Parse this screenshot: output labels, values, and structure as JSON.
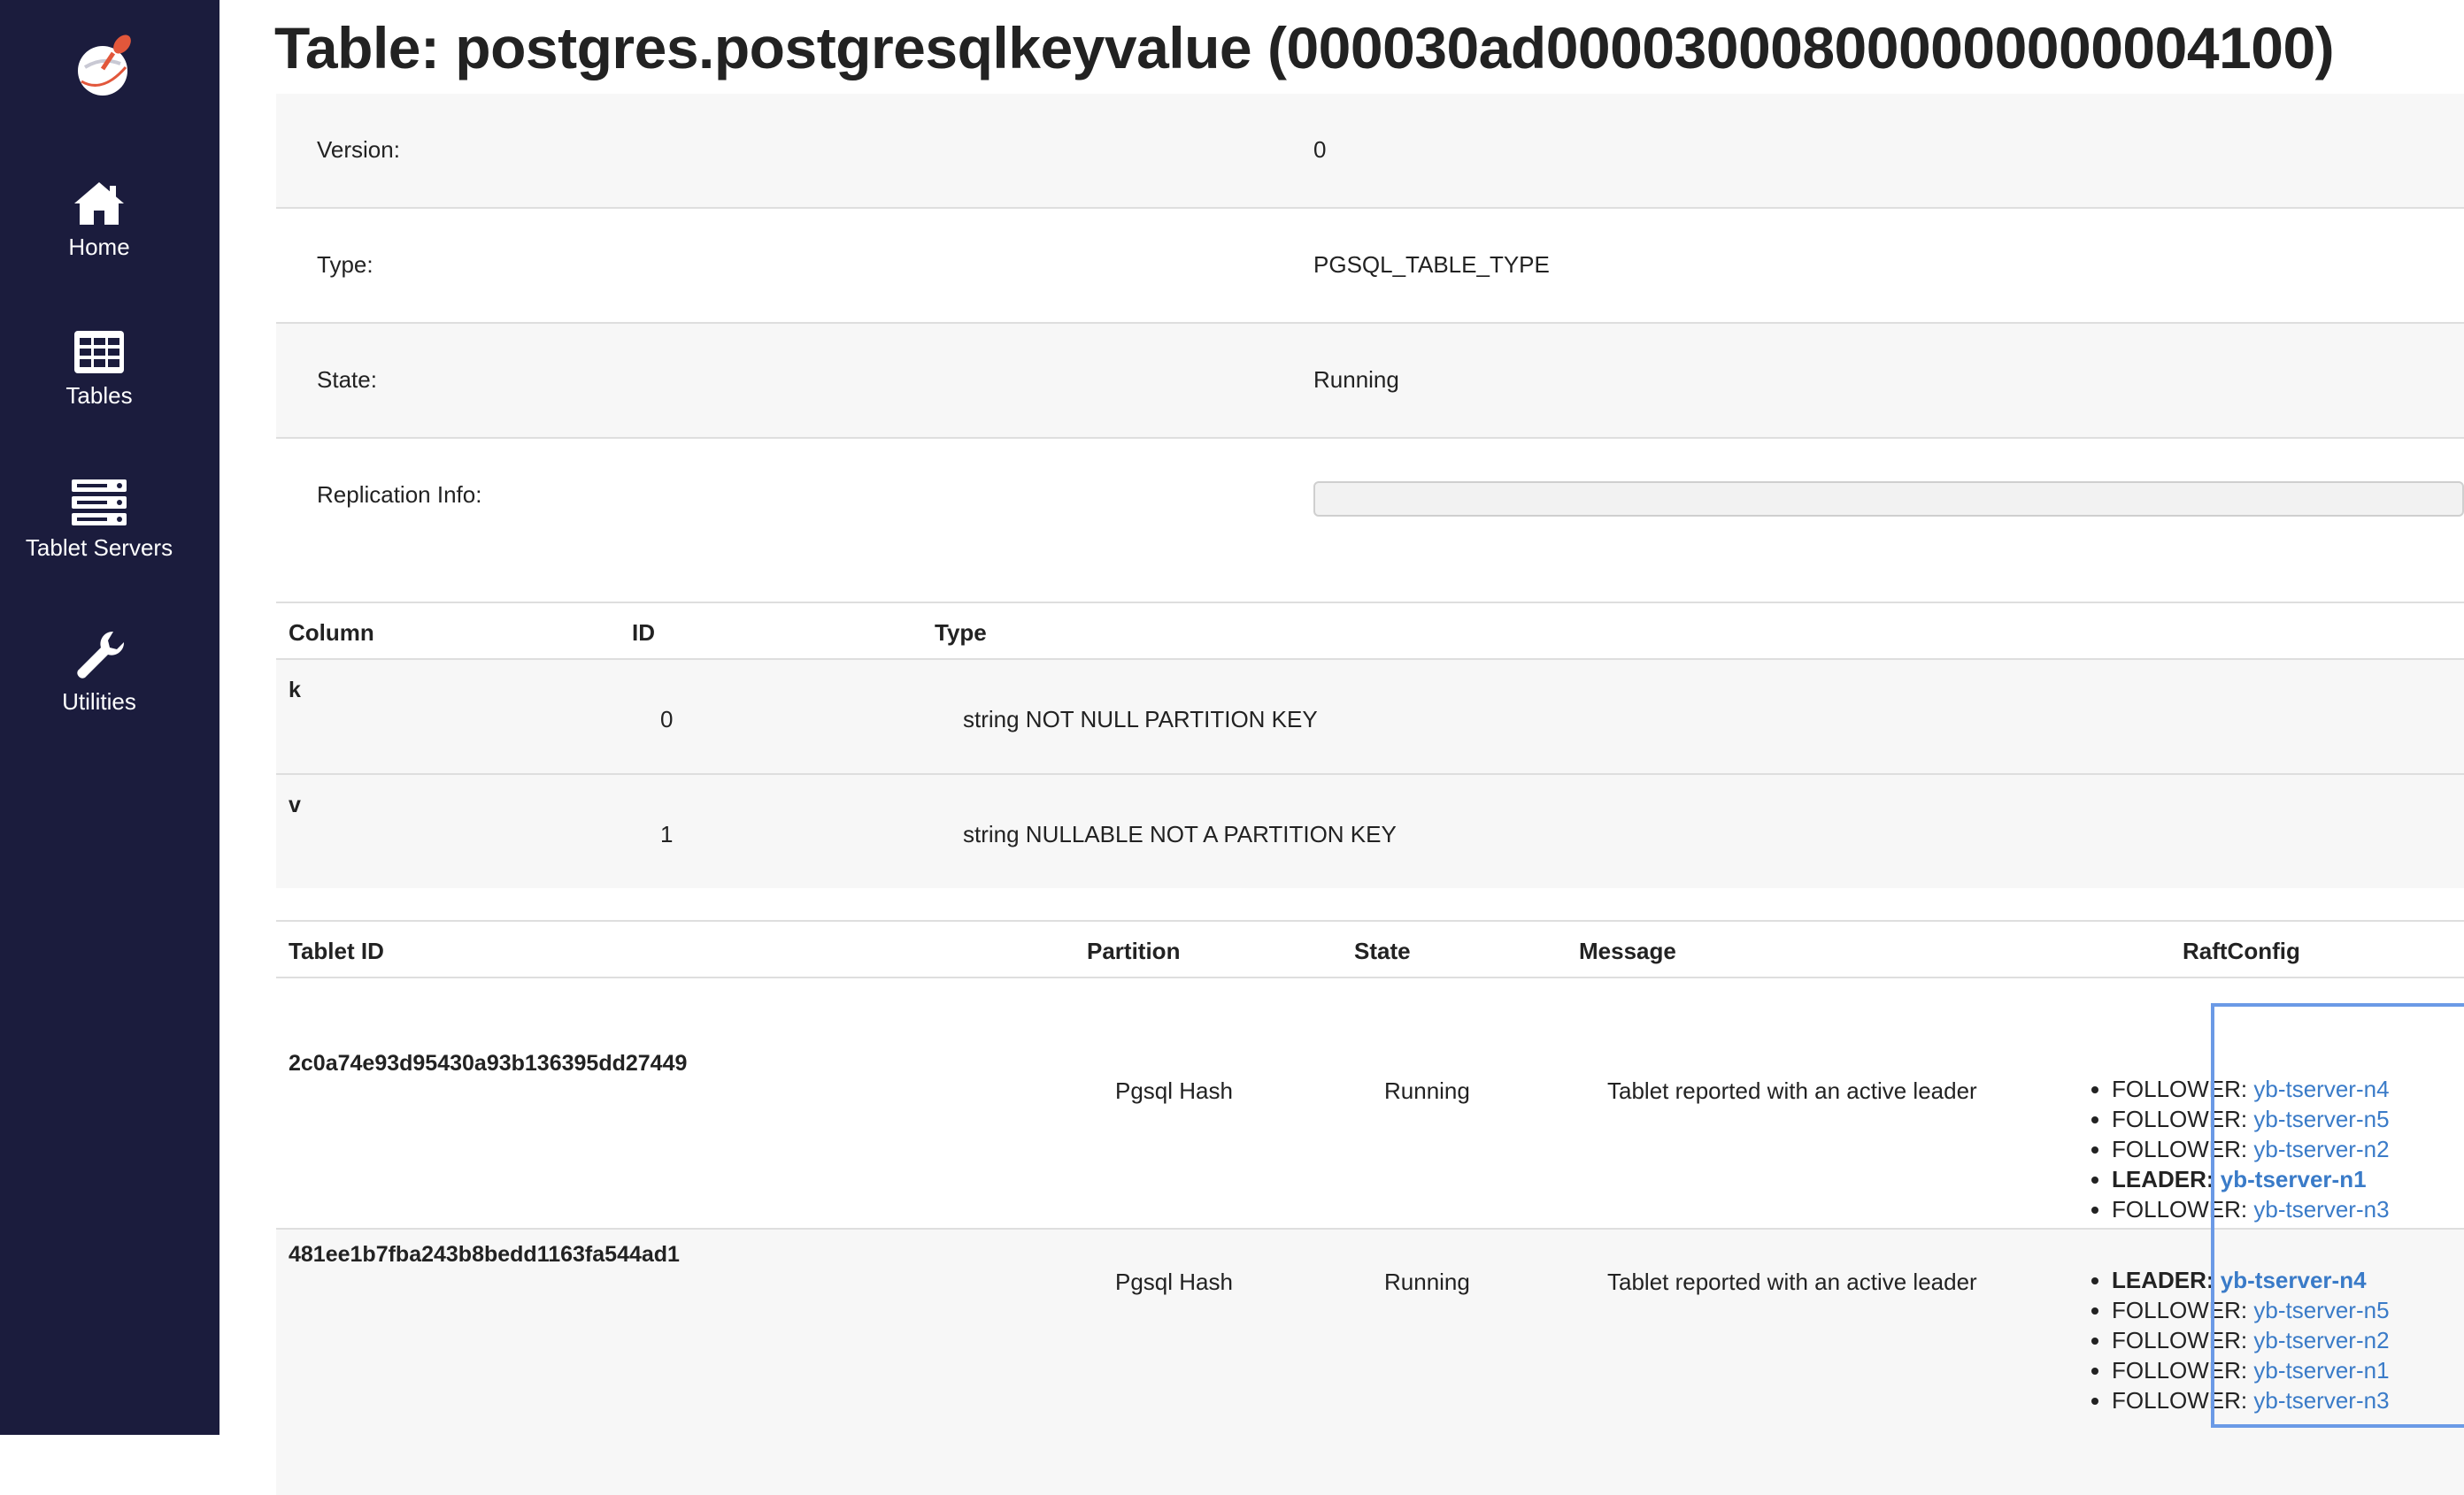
{
  "sidebar": {
    "items": [
      {
        "label": "Home",
        "icon": "home-icon"
      },
      {
        "label": "Tables",
        "icon": "table-icon"
      },
      {
        "label": "Tablet Servers",
        "icon": "server-icon"
      },
      {
        "label": "Utilities",
        "icon": "wrench-icon"
      }
    ]
  },
  "page": {
    "title": "Table: postgres.postgresqlkeyvalue (000030ad000030008000000000004100)"
  },
  "info": {
    "version_label": "Version:",
    "version_value": "0",
    "type_label": "Type:",
    "type_value": "PGSQL_TABLE_TYPE",
    "state_label": "State:",
    "state_value": "Running",
    "replication_label": "Replication Info:"
  },
  "columns": {
    "headers": {
      "column": "Column",
      "id": "ID",
      "type": "Type"
    },
    "rows": [
      {
        "name": "k",
        "id": "0",
        "type": "string NOT NULL PARTITION KEY"
      },
      {
        "name": "v",
        "id": "1",
        "type": "string NULLABLE NOT A PARTITION KEY"
      }
    ]
  },
  "tablets": {
    "headers": {
      "tablet_id": "Tablet ID",
      "partition": "Partition",
      "state": "State",
      "message": "Message",
      "raft": "RaftConfig"
    },
    "rows": [
      {
        "tablet_id": "2c0a74e93d95430a93b136395dd27449",
        "partition": "Pgsql Hash",
        "state": "Running",
        "message": "Tablet reported with an active leader",
        "raft": [
          {
            "role": "FOLLOWER:",
            "server": "yb-tserver-n4"
          },
          {
            "role": "FOLLOWER:",
            "server": "yb-tserver-n5"
          },
          {
            "role": "FOLLOWER:",
            "server": "yb-tserver-n2"
          },
          {
            "role": "LEADER:",
            "server": "yb-tserver-n1"
          },
          {
            "role": "FOLLOWER:",
            "server": "yb-tserver-n3"
          }
        ]
      },
      {
        "tablet_id": "481ee1b7fba243b8bedd1163fa544ad1",
        "partition": "Pgsql Hash",
        "state": "Running",
        "message": "Tablet reported with an active leader",
        "raft": [
          {
            "role": "LEADER:",
            "server": "yb-tserver-n4"
          },
          {
            "role": "FOLLOWER:",
            "server": "yb-tserver-n5"
          },
          {
            "role": "FOLLOWER:",
            "server": "yb-tserver-n2"
          },
          {
            "role": "FOLLOWER:",
            "server": "yb-tserver-n1"
          },
          {
            "role": "FOLLOWER:",
            "server": "yb-tserver-n3"
          }
        ]
      }
    ]
  },
  "colors": {
    "sidebar_bg": "#1b1c3d",
    "link": "#3a7bc8",
    "highlight": "#6b9ae6"
  }
}
